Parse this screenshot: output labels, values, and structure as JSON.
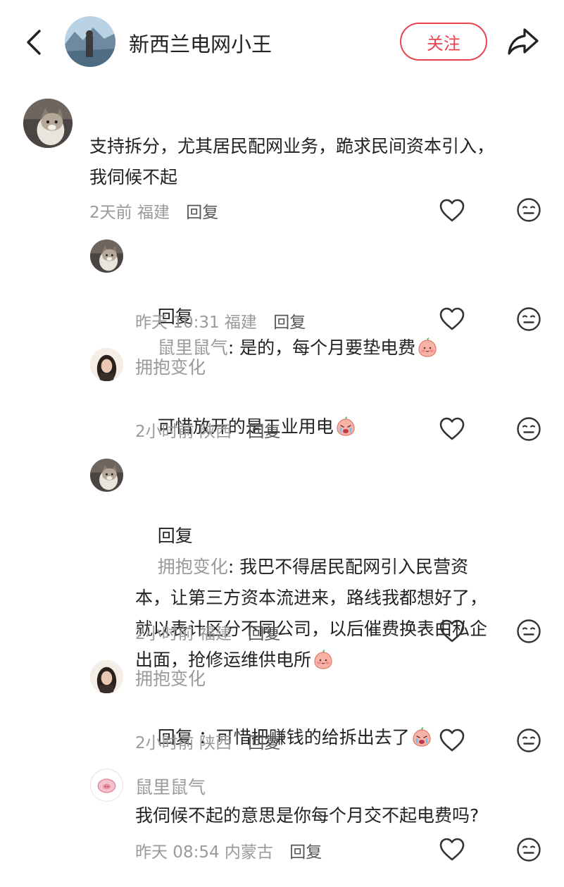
{
  "header": {
    "title": "新西兰电网小王",
    "follow_label": "关注"
  },
  "comments": [
    {
      "text": "支持拆分，尤其居民配网业务，跪求民间资本引入，\n我伺候不起",
      "time": "2天前",
      "location": "福建",
      "reply_label": "回复"
    },
    {
      "reply_prefix": "回复",
      "reply_to": "鼠里鼠气",
      "text": ": 是的，每个月要垫电费",
      "emoji": "smile-emoji",
      "time": "昨天 10:31",
      "location": "福建",
      "reply_label": "回复"
    },
    {
      "author": "拥抱变化",
      "text": "可惜放开的是工业用电",
      "emoji": "crying-emoji",
      "time": "2小时前",
      "location": "陕西",
      "reply_label": "回复"
    },
    {
      "reply_prefix": "回复",
      "reply_to": "拥抱变化",
      "text_line1": ": 我巴不得居民配网引入民营资",
      "text_rest": "本，让第三方资本流进来，路线我都想好了，\n就以表计区分不同公司，以后催费换表由私企\n出面，抢修运维供电所",
      "emoji": "smile-emoji",
      "time": "2小时前",
      "location": "福建",
      "reply_label": "回复"
    },
    {
      "author": "拥抱变化",
      "text": "回复 ：可惜把赚钱的给拆出去了",
      "emoji": "crying-emoji",
      "time": "2小时前",
      "location": "陕西",
      "reply_label": "回复"
    },
    {
      "author": "鼠里鼠气",
      "text": "我伺候不起的意思是你每个月交不起电费吗?",
      "time": "昨天 08:54",
      "location": "内蒙古",
      "reply_label": "回复"
    }
  ],
  "colors": {
    "accent": "#e8434f",
    "gray": "#9a9a9a"
  },
  "icons": [
    "back-arrow-icon",
    "share-icon",
    "heart-icon",
    "neutral-face-icon",
    "smile-emoji",
    "crying-emoji"
  ]
}
